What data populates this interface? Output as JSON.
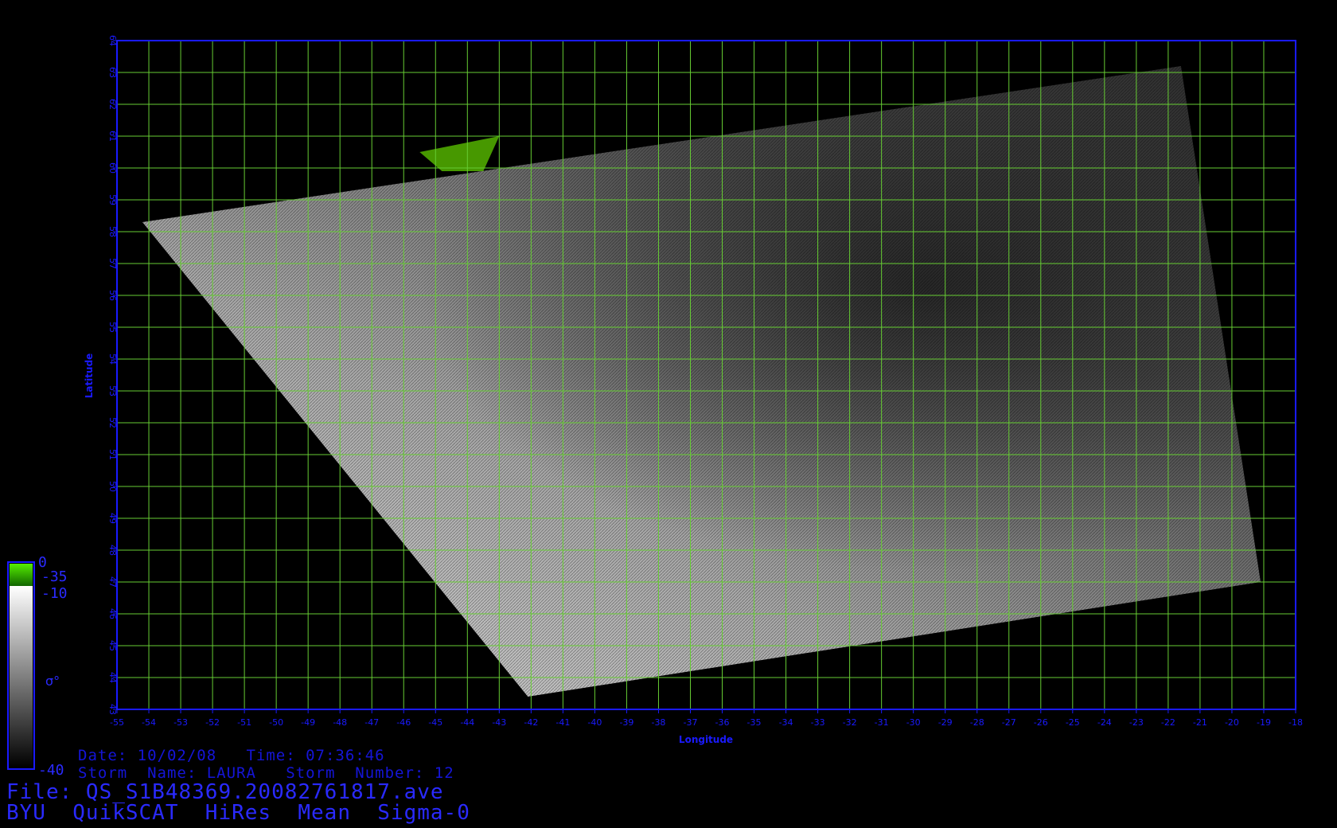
{
  "map": {
    "lon_min": -55,
    "lon_max": -18,
    "lat_min": 43,
    "lat_max": 64,
    "x_label": "Longitude",
    "y_label": "Latitude",
    "grid": true,
    "grid_color": "#66cc33",
    "frame_color": "#1a1aff",
    "x_ticks": [
      "-55",
      "-54",
      "-53",
      "-52",
      "-51",
      "-50",
      "-49",
      "-48",
      "-47",
      "-46",
      "-45",
      "-44",
      "-43",
      "-42",
      "-41",
      "-40",
      "-39",
      "-38",
      "-37",
      "-36",
      "-35",
      "-34",
      "-33",
      "-32",
      "-31",
      "-30",
      "-29",
      "-28",
      "-27",
      "-26",
      "-25",
      "-24",
      "-23",
      "-22",
      "-21",
      "-20",
      "-19",
      "-18"
    ],
    "y_ticks": [
      "43",
      "44",
      "45",
      "46",
      "47",
      "48",
      "49",
      "50",
      "51",
      "52",
      "53",
      "54",
      "55",
      "56",
      "57",
      "58",
      "59",
      "60",
      "61",
      "62",
      "63",
      "64"
    ],
    "swath_corners_lonlat": [
      [
        -54.2,
        58.3
      ],
      [
        -21.6,
        63.2
      ],
      [
        -19.1,
        47.0
      ],
      [
        -42.1,
        43.4
      ]
    ]
  },
  "colorbar": {
    "symbol": "σ°",
    "labels": {
      "top": "0",
      "green_low": "-35",
      "gray_top": "-10",
      "bottom": "-40"
    },
    "colors": {
      "green_top": "#55ee00",
      "green_bottom": "#116600",
      "gray_top": "#ffffff",
      "gray_bottom": "#000000"
    }
  },
  "info": {
    "date_line": "Date: 10/02/08   Time: 07:36:46",
    "storm_line": "Storm  Name: LAURA   Storm  Number: 12",
    "file_line": "File: QS_S1B48369.20082761817.ave",
    "product_line": "BYU  QuikSCAT  HiRes  Mean  Sigma-0"
  }
}
